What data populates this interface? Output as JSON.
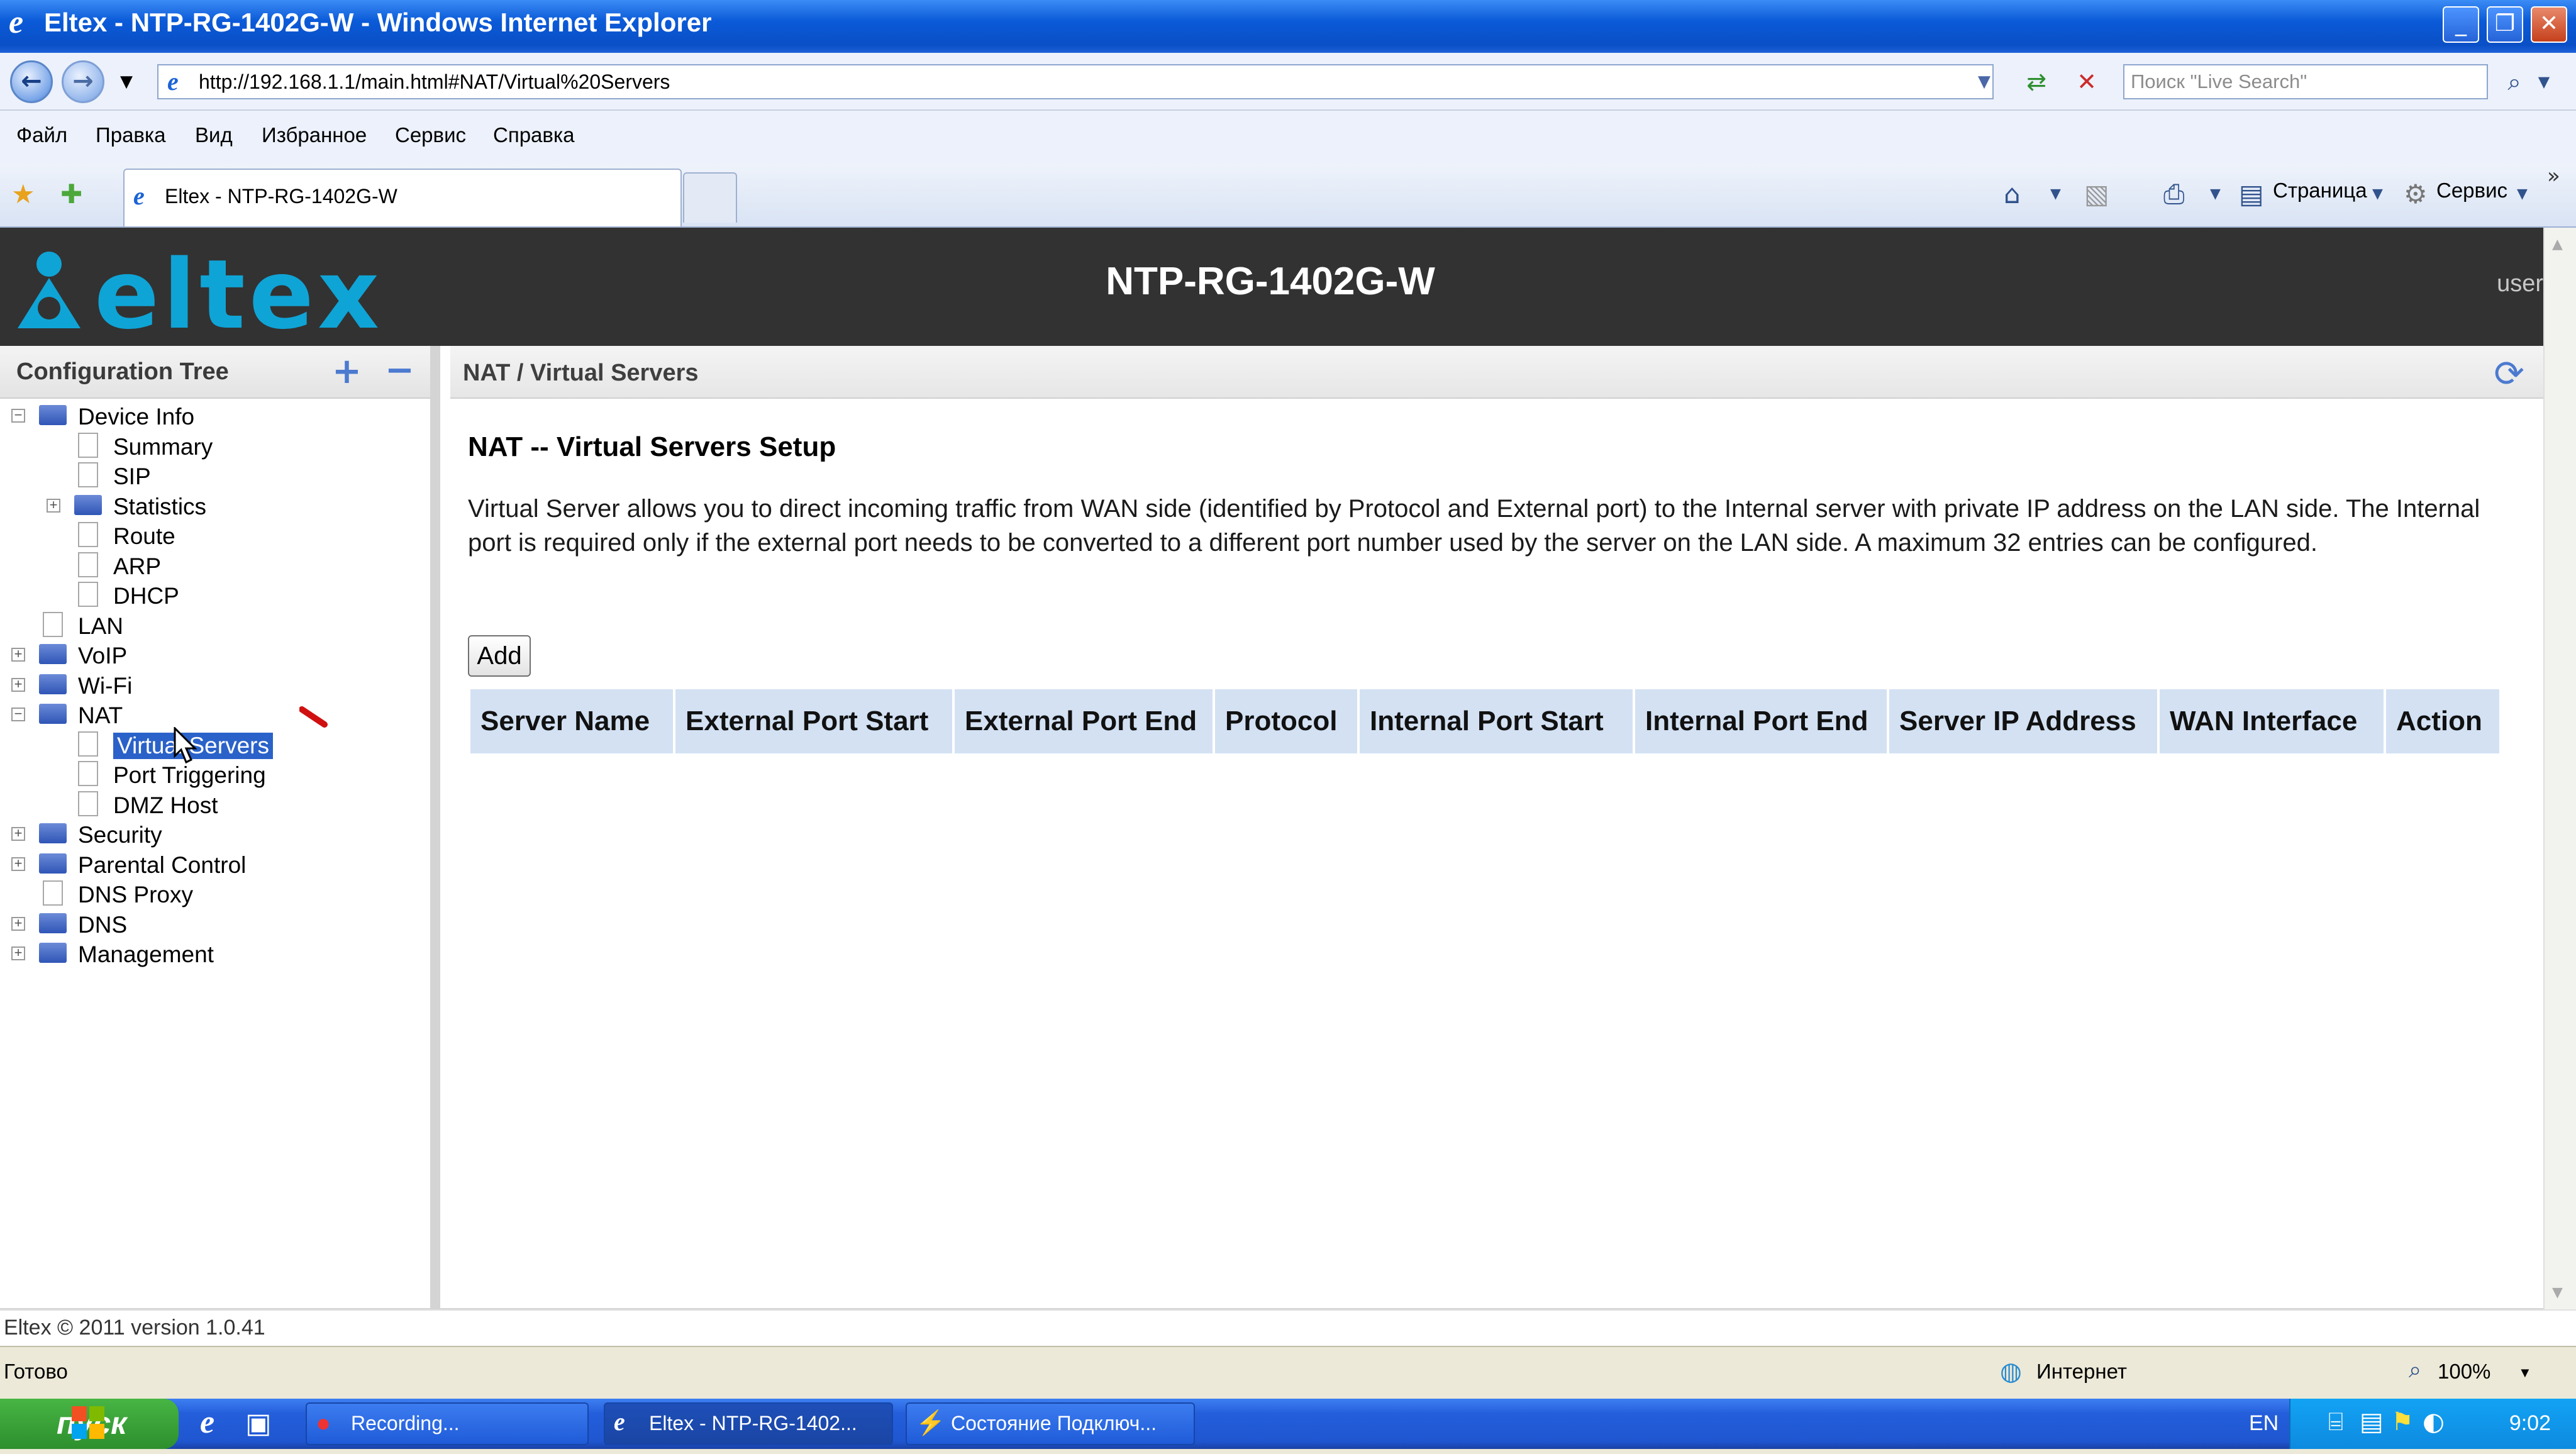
{
  "window": {
    "title": "Eltex - NTP-RG-1402G-W - Windows Internet Explorer"
  },
  "address_bar": {
    "url": "http://192.168.1.1/main.html#NAT/Virtual%20Servers",
    "search_placeholder": "Поиск \"Live Search\""
  },
  "menu": [
    "Файл",
    "Правка",
    "Вид",
    "Избранное",
    "Сервис",
    "Справка"
  ],
  "tab": {
    "title": "Eltex - NTP-RG-1402G-W"
  },
  "toolbar": {
    "page_label": "Страница",
    "tools_label": "Сервис"
  },
  "header": {
    "logo_text": "eltex",
    "model": "NTP-RG-1402G-W",
    "user": "user",
    "logo_color": "#0fa4d6"
  },
  "tree": {
    "title": "Configuration Tree",
    "expand_icon": "plus-icon",
    "collapse_icon": "minus-icon",
    "items": [
      {
        "label": "Device Info",
        "level": 0,
        "kind": "folder",
        "toggle": "−"
      },
      {
        "label": "Summary",
        "level": 1,
        "kind": "doc",
        "toggle": ""
      },
      {
        "label": "SIP",
        "level": 1,
        "kind": "doc",
        "toggle": ""
      },
      {
        "label": "Statistics",
        "level": 1,
        "kind": "folder",
        "toggle": "+"
      },
      {
        "label": "Route",
        "level": 1,
        "kind": "doc",
        "toggle": ""
      },
      {
        "label": "ARP",
        "level": 1,
        "kind": "doc",
        "toggle": ""
      },
      {
        "label": "DHCP",
        "level": 1,
        "kind": "doc",
        "toggle": ""
      },
      {
        "label": "LAN",
        "level": 0,
        "kind": "doc",
        "toggle": ""
      },
      {
        "label": "VoIP",
        "level": 0,
        "kind": "folder",
        "toggle": "+"
      },
      {
        "label": "Wi-Fi",
        "level": 0,
        "kind": "folder",
        "toggle": "+"
      },
      {
        "label": "NAT",
        "level": 0,
        "kind": "folder",
        "toggle": "−"
      },
      {
        "label": "Virtual Servers",
        "level": 1,
        "kind": "doc",
        "toggle": "",
        "selected": true
      },
      {
        "label": "Port Triggering",
        "level": 1,
        "kind": "doc",
        "toggle": ""
      },
      {
        "label": "DMZ Host",
        "level": 1,
        "kind": "doc",
        "toggle": ""
      },
      {
        "label": "Security",
        "level": 0,
        "kind": "folder",
        "toggle": "+"
      },
      {
        "label": "Parental Control",
        "level": 0,
        "kind": "folder",
        "toggle": "+"
      },
      {
        "label": "DNS Proxy",
        "level": 0,
        "kind": "doc",
        "toggle": ""
      },
      {
        "label": "DNS",
        "level": 0,
        "kind": "folder",
        "toggle": "+"
      },
      {
        "label": "Management",
        "level": 0,
        "kind": "folder",
        "toggle": "+"
      }
    ]
  },
  "content": {
    "breadcrumb": "NAT / Virtual Servers",
    "heading": "NAT -- Virtual Servers Setup",
    "description": "Virtual Server allows you to direct incoming traffic from WAN side (identified by Protocol and External port) to the Internal server with private IP address on the LAN side. The Internal port is required only if the external port needs to be converted to a different port number used by the server on the LAN side. A maximum 32 entries can be configured.",
    "add_label": "Add",
    "table_headers": [
      "Server Name",
      "External Port Start",
      "External Port End",
      "Protocol",
      "Internal Port Start",
      "Internal Port End",
      "Server IP Address",
      "WAN Interface",
      "Action"
    ]
  },
  "footer": {
    "copyright": "Eltex © 2011 version 1.0.41"
  },
  "status": {
    "text": "Готово",
    "zone": "Интернет",
    "zoom": "100%"
  },
  "taskbar": {
    "start_label": "пуск",
    "items": [
      "Recording...",
      "Eltex - NTP-RG-1402...",
      "Состояние Подключ..."
    ],
    "lang": "EN",
    "clock": "9:02"
  }
}
